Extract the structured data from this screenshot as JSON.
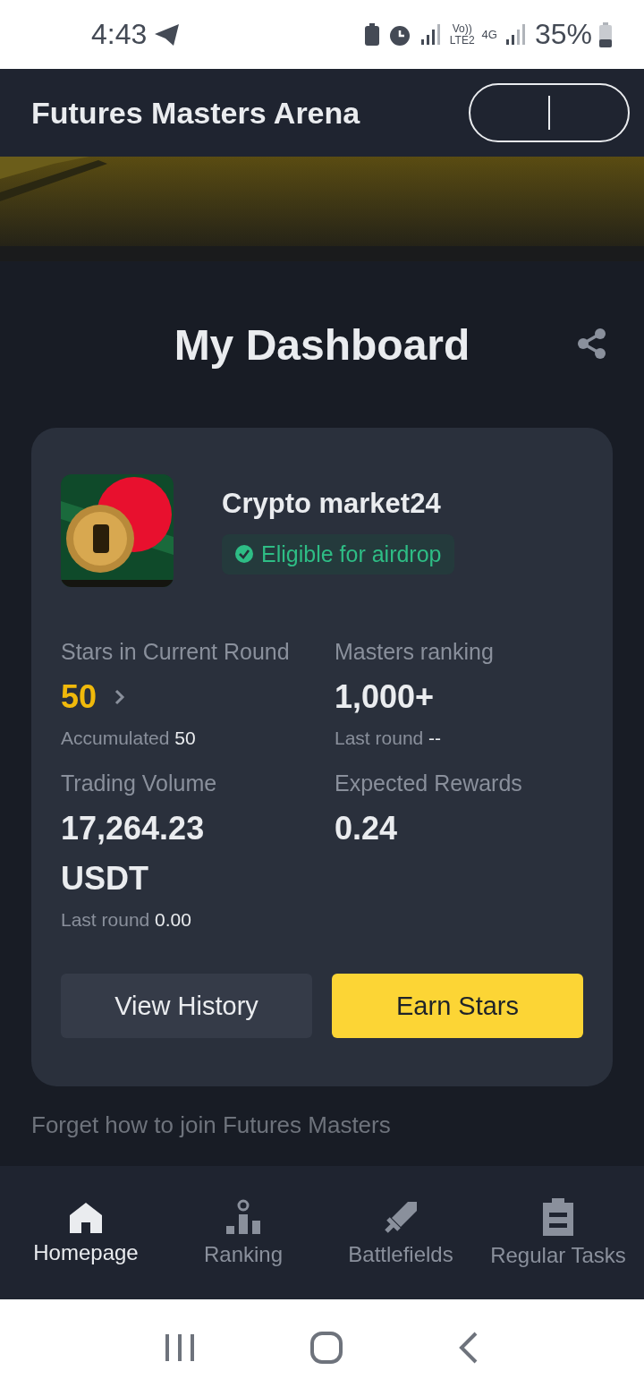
{
  "status_bar": {
    "time": "4:43",
    "volte": "Vo))",
    "lte": "LTE2",
    "network": "4G",
    "battery": "35%"
  },
  "header": {
    "title": "Futures Masters Arena"
  },
  "dashboard": {
    "title": "My Dashboard"
  },
  "profile": {
    "name": "Crypto market24",
    "badge": {
      "label": "Eligible for airdrop",
      "eligible": true
    }
  },
  "stats": [
    {
      "label": "Stars in Current Round",
      "value": "50",
      "accent": true,
      "link": true,
      "sub_label": "Accumulated",
      "sub_value": "50"
    },
    {
      "label": "Masters ranking",
      "value": "1,000+",
      "accent": false,
      "link": false,
      "sub_label": "Last round",
      "sub_value": "--"
    },
    {
      "label": "Trading Volume",
      "value": "17,264.23 USDT",
      "accent": false,
      "link": false,
      "sub_label": "Last round",
      "sub_value": "0.00"
    },
    {
      "label": "Expected Rewards",
      "value": "0.24",
      "accent": false,
      "link": false
    }
  ],
  "buttons": [
    {
      "label": "View History",
      "kind": "secondary"
    },
    {
      "label": "Earn Stars",
      "kind": "primary"
    }
  ],
  "footer_text": "Forget how to join Futures Masters",
  "nav": [
    {
      "label": "Homepage",
      "kind": "home",
      "selected": true
    },
    {
      "label": "Ranking",
      "kind": "ranking",
      "selected": false
    },
    {
      "label": "Battlefields",
      "kind": "battle",
      "selected": false
    },
    {
      "label": "Regular Tasks",
      "kind": "tasks",
      "selected": false
    }
  ]
}
